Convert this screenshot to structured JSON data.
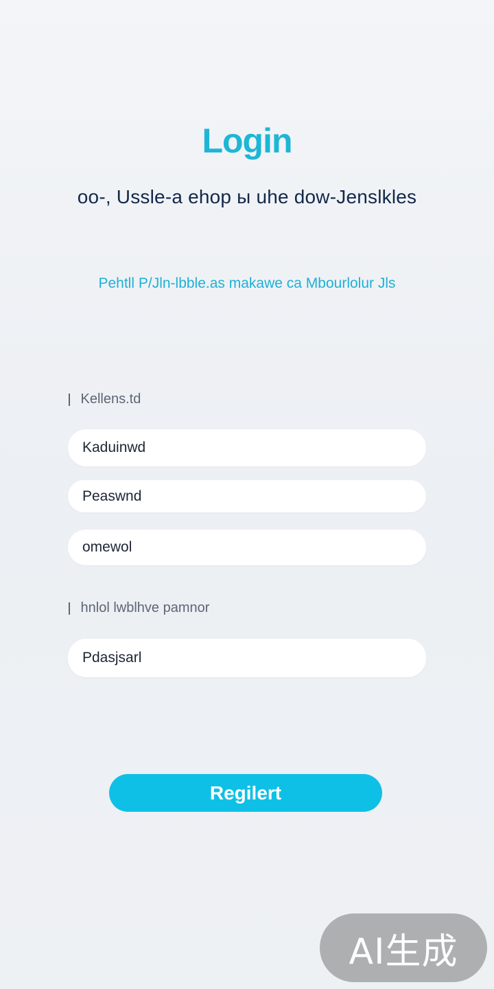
{
  "header": {
    "title": "Login",
    "subtitle": "oo-, Ussle-a ehop ы uhe dow-Jenslkles",
    "tagline": "Pehtll P/Jln-lbble.as makawe ca Mbourlolur Jls"
  },
  "form": {
    "section1_label": "Kellens.td",
    "fields": [
      {
        "value": "Kaduinwd"
      },
      {
        "value": "Peaswnd"
      },
      {
        "value": "omewol"
      }
    ],
    "section2_label": "hnlol lwblhve pamnor",
    "field4": {
      "value": "Pdasjsarl"
    }
  },
  "actions": {
    "register_label": "Regilert"
  },
  "watermark": {
    "text": "AI生成"
  },
  "colors": {
    "accent": "#1db6d6",
    "button": "#0fc0e6",
    "heading_dark": "#12284a",
    "background": "#eef1f5"
  }
}
